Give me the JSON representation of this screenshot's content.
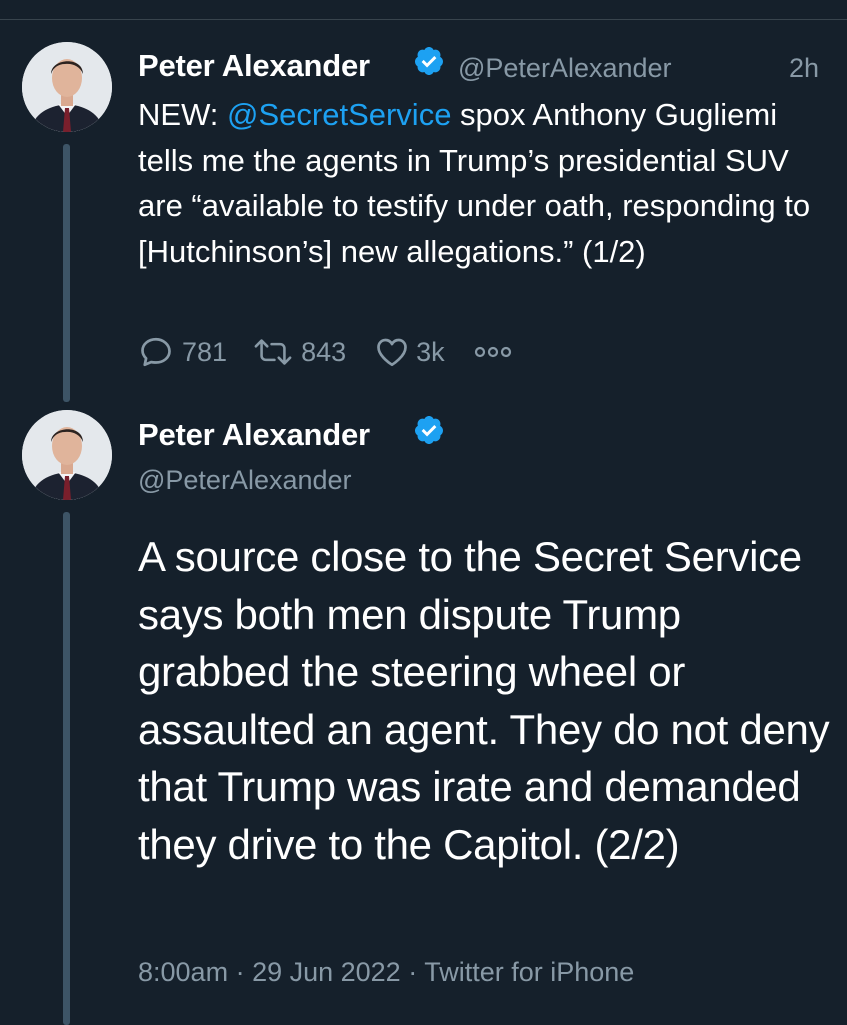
{
  "theme": {
    "background": "#15202b",
    "text": "#ffffff",
    "secondary": "#8899a6",
    "accent": "#1da1f2",
    "thread_line": "#3d5466",
    "divider": "#38444d"
  },
  "tweets": [
    {
      "author": {
        "name": "Peter Alexander",
        "handle": "@PeterAlexander",
        "verified": true,
        "avatar_icon": "profile-photo-avatar"
      },
      "time": "2h",
      "text": {
        "prefix": "NEW: ",
        "mention": "@SecretService",
        "body": " spox Anthony Gugliemi tells me the agents in Trump’s presidential SUV are “available to testify under oath, responding to [Hutchinson’s] new allegations.” (1/2)"
      },
      "actions": {
        "replies": "781",
        "retweets": "843",
        "likes": "3k",
        "reply_icon": "reply-icon",
        "retweet_icon": "retweet-icon",
        "like_icon": "heart-icon",
        "more_icon": "more-icon"
      }
    },
    {
      "author": {
        "name": "Peter Alexander",
        "handle": "@PeterAlexander",
        "verified": true,
        "avatar_icon": "profile-photo-avatar"
      },
      "text": "A source close to the Secret Service says both men dispute Trump grabbed the steering wheel or assaulted an agent. They do not deny that Trump was irate and demanded they drive to the Capitol. (2/2)",
      "meta": {
        "time": "8:00am",
        "date": "29 Jun 2022",
        "source": "Twitter for iPhone",
        "separator": " · "
      }
    }
  ]
}
